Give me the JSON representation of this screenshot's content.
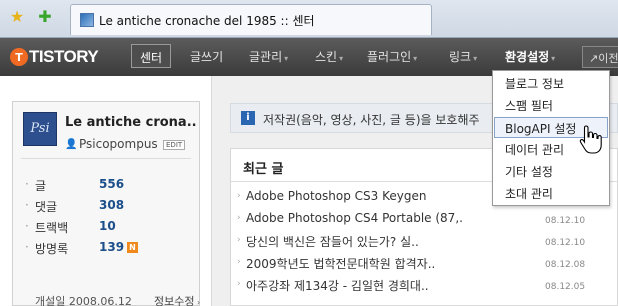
{
  "browser": {
    "tab_title": "Le antiche cronache del 1985 :: 센터"
  },
  "nav": {
    "logo": "TISTORY",
    "items": [
      "센터",
      "글쓰기",
      "글관리",
      "스킨",
      "플러그인",
      "링크",
      "환경설정"
    ],
    "prev": "이전"
  },
  "profile": {
    "blog_name": "Le antiche crona..",
    "avatar_text": "Psi",
    "username": "Psicopompus",
    "edit": "EDIT",
    "stats": [
      {
        "label": "글",
        "value": "556"
      },
      {
        "label": "댓글",
        "value": "308"
      },
      {
        "label": "트랙백",
        "value": "10"
      },
      {
        "label": "방명록",
        "value": "139"
      }
    ],
    "new_badge": "N",
    "opened": "개설일 2008.06.12",
    "info_edit": "정보수정"
  },
  "notice": {
    "text": "저작권(음악, 영상, 사진, 글 등)을 보호해주"
  },
  "recent": {
    "header": "최근 글",
    "posts": [
      {
        "title": "Adobe Photoshop CS3 Keygen",
        "date": ""
      },
      {
        "title": "Adobe Photoshop CS4 Portable (87,.",
        "date": "08.12.10"
      },
      {
        "title": "당신의 백신은 잠들어 있는가? 실..",
        "date": "08.12.10"
      },
      {
        "title": "2009학년도 법학전문대학원 합격자..",
        "date": "08.12.08"
      },
      {
        "title": "아주강좌 제134강 - 김일현 경희대..",
        "date": "08.12.05"
      }
    ]
  },
  "dropdown": {
    "items": [
      "블로그 정보",
      "스팸 필터",
      "BlogAPI 설정",
      "데이터 관리",
      "기타 설정",
      "초대 관리"
    ],
    "hover_index": 2
  }
}
